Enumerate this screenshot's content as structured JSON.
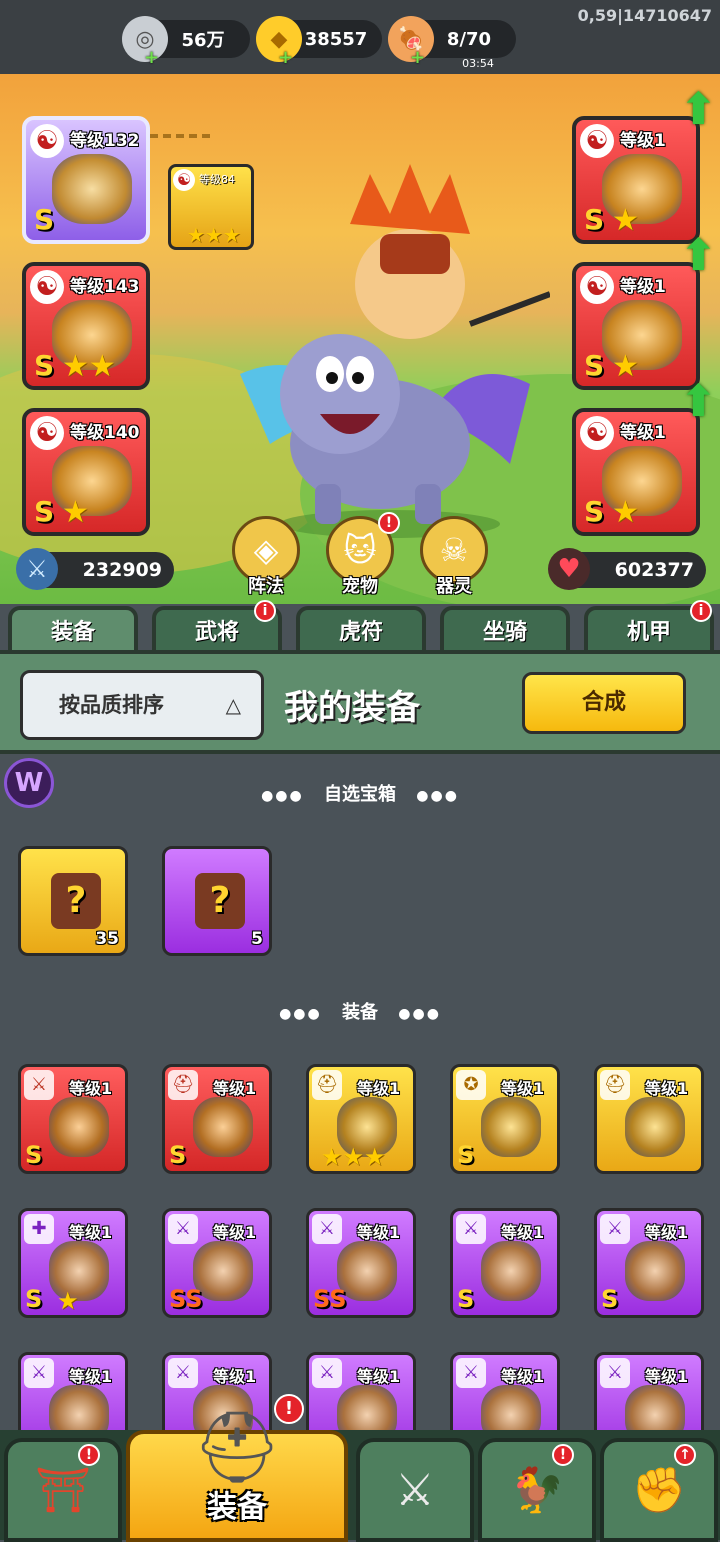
{
  "top_bar": {
    "silver": "56万",
    "gold": "38557",
    "stamina": "8/70",
    "stamina_timer": "03:54",
    "server_info": "0,59|14710647"
  },
  "scene": {
    "left_slots": [
      {
        "level": "等级132",
        "grade": "S",
        "stars": "",
        "style": "purple"
      },
      {
        "level": "等级143",
        "grade": "S",
        "stars": "★★",
        "style": "red"
      },
      {
        "level": "等级140",
        "grade": "S",
        "stars": "★",
        "style": "red"
      }
    ],
    "sub_slot": {
      "level": "等级84",
      "stars": "★★★"
    },
    "right_slots": [
      {
        "level": "等级1",
        "grade": "S",
        "stars": "★"
      },
      {
        "level": "等级1",
        "grade": "S",
        "stars": "★"
      },
      {
        "level": "等级1",
        "grade": "S",
        "stars": "★"
      }
    ],
    "attack": "232909",
    "health": "602377",
    "features": [
      {
        "label": "阵法",
        "icon": "formation-icon",
        "alert": false
      },
      {
        "label": "宠物",
        "icon": "pet-icon",
        "alert": true
      },
      {
        "label": "器灵",
        "icon": "spirit-icon",
        "alert": false
      }
    ]
  },
  "tabs": [
    {
      "label": "装备",
      "active": true,
      "alert": false
    },
    {
      "label": "武将",
      "active": false,
      "alert": true
    },
    {
      "label": "虎符",
      "active": false,
      "alert": false
    },
    {
      "label": "坐骑",
      "active": false,
      "alert": false
    },
    {
      "label": "机甲",
      "active": false,
      "alert": true
    }
  ],
  "panel": {
    "sort_label": "按品质排序",
    "title": "我的装备",
    "synth_label": "合成"
  },
  "list": {
    "section1": "自选宝箱",
    "chests": [
      {
        "count": "35",
        "style": "gold"
      },
      {
        "count": "5",
        "style": "purple"
      }
    ],
    "section2": "装备",
    "row1": [
      {
        "level": "等级1",
        "grade": "S",
        "stars": "",
        "style": "red",
        "icon": "sword-icon"
      },
      {
        "level": "等级1",
        "grade": "S",
        "stars": "",
        "style": "red",
        "icon": "helmet-icon"
      },
      {
        "level": "等级1",
        "grade": "",
        "stars": "★★★",
        "style": "gold",
        "icon": "helmet-icon"
      },
      {
        "level": "等级1",
        "grade": "S",
        "stars": "",
        "style": "gold",
        "icon": "medal-icon"
      },
      {
        "level": "等级1",
        "grade": "",
        "stars": "",
        "style": "gold",
        "icon": "helmet-icon"
      }
    ],
    "row2": [
      {
        "level": "等级1",
        "grade": "S",
        "stars": "★",
        "style": "purple",
        "icon": "armor-icon"
      },
      {
        "level": "等级1",
        "grade": "SS",
        "stars": "",
        "style": "purple",
        "icon": "sword-icon"
      },
      {
        "level": "等级1",
        "grade": "SS",
        "stars": "",
        "style": "purple",
        "icon": "sword-icon"
      },
      {
        "level": "等级1",
        "grade": "S",
        "stars": "",
        "style": "purple",
        "icon": "sword-icon"
      },
      {
        "level": "等级1",
        "grade": "S",
        "stars": "",
        "style": "purple",
        "icon": "sword-icon"
      }
    ],
    "row3": [
      {
        "level": "等级1",
        "style": "purple",
        "icon": "sword-icon"
      },
      {
        "level": "等级1",
        "style": "purple",
        "icon": "sword-icon"
      },
      {
        "level": "等级1",
        "style": "purple",
        "icon": "sword-icon"
      },
      {
        "level": "等级1",
        "style": "purple",
        "icon": "sword-icon"
      },
      {
        "level": "等级1",
        "style": "purple",
        "icon": "sword-icon"
      }
    ]
  },
  "bottom_nav": {
    "active_label": "装备",
    "items": [
      {
        "icon": "shop-gate-icon",
        "alert": true
      },
      {
        "icon": "helmet-icon",
        "alert": true
      },
      {
        "icon": "battle-shield-icon",
        "alert": false
      },
      {
        "icon": "rooster-icon",
        "alert": true
      },
      {
        "icon": "upgrade-fist-icon",
        "alert": true
      }
    ]
  },
  "colors": {
    "red_quality": "#d62828",
    "gold_quality": "#f0b020",
    "purple_quality": "#9b2ee0",
    "tab_green": "#5f8d6d",
    "synth_yellow": "#ffd530"
  }
}
